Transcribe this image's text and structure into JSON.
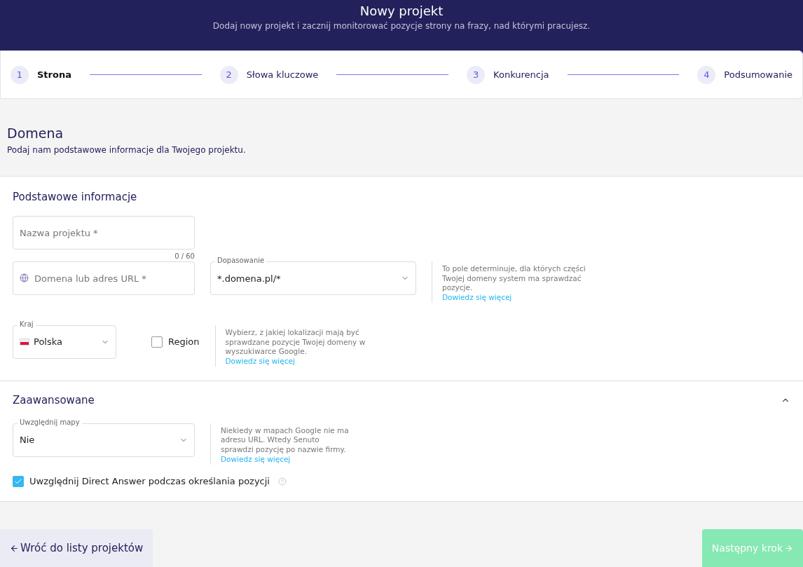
{
  "header": {
    "title": "Nowy projekt",
    "subtitle": "Dodaj nowy projekt i zacznij monitorować pozycje strony na frazy, nad którymi pracujesz."
  },
  "steps": [
    {
      "number": "1",
      "label": "Strona",
      "selected": true
    },
    {
      "number": "2",
      "label": "Słowa kluczowe",
      "selected": false
    },
    {
      "number": "3",
      "label": "Konkurencja",
      "selected": false
    },
    {
      "number": "4",
      "label": "Podsumowanie",
      "selected": false
    }
  ],
  "intro": {
    "title": "Domena",
    "subtitle": "Podaj nam podstawowe informacje dla Twojego projektu."
  },
  "basic": {
    "title": "Podstawowe informacje",
    "project_name": {
      "placeholder": "Nazwa projektu *",
      "counter": "0 / 60"
    },
    "domain": {
      "placeholder": "Domena lub adres URL *"
    },
    "matching": {
      "label": "Dopasowanie",
      "value": "*.domena.pl/*"
    },
    "matching_help": {
      "text": "To pole determinuje, dla których części Twojej domeny system ma sprawdzać pozycje.",
      "link": "Dowiedz się więcej"
    },
    "country": {
      "label": "Kraj",
      "value": "Polska"
    },
    "region": {
      "label": "Region",
      "checked": false
    },
    "country_help": {
      "text": "Wybierz, z jakiej lokalizacji mają być sprawdzane pozycje Twojej domeny w wyszukiwarce Google.",
      "link": "Dowiedz się więcej"
    }
  },
  "advanced": {
    "title": "Zaawansowane",
    "expanded": true,
    "maps": {
      "label": "Uwzględnij mapy",
      "value": "Nie"
    },
    "maps_help": {
      "text": "Niekiedy w mapach Google nie ma adresu URL. Wtedy Senuto sprawdzi pozycję po nazwie firmy.",
      "link": "Dowiedz się więcej"
    },
    "direct_answer": {
      "label": "Uwzględnij Direct Answer podczas określania pozycji",
      "checked": true
    }
  },
  "footer": {
    "back": "Wróć do listy projektów",
    "next": {
      "label": "Następny krok",
      "disabled": true
    }
  }
}
